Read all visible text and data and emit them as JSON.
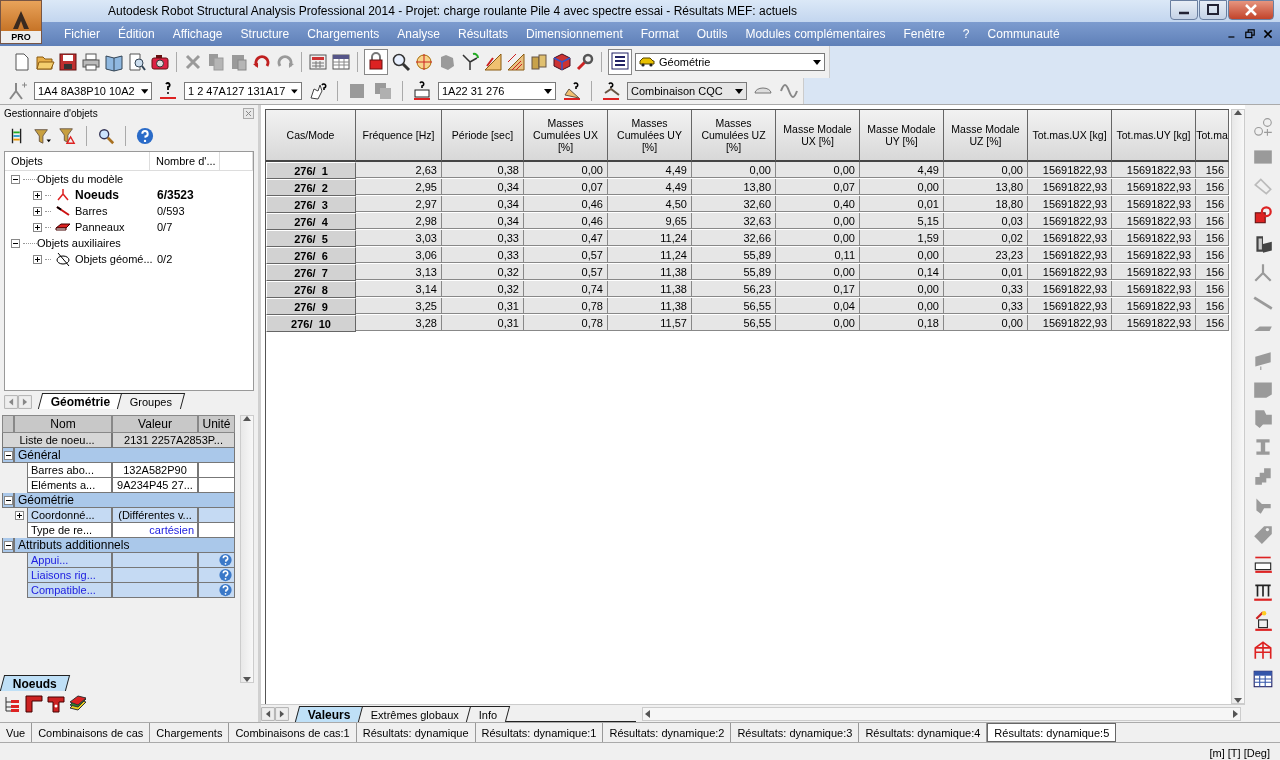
{
  "window": {
    "title": "Autodesk Robot Structural Analysis Professional 2014 - Projet: charge roulante Pile 4 avec spectre essai - Résultats MEF: actuels",
    "logo": "PRO"
  },
  "menu": [
    "Fichier",
    "Édition",
    "Affichage",
    "Structure",
    "Chargements",
    "Analyse",
    "Résultats",
    "Dimensionnement",
    "Format",
    "Outils",
    "Modules complémentaires",
    "Fenêtre",
    "?",
    "Communauté"
  ],
  "toolbar": {
    "view_selector": "Géométrie"
  },
  "selection_bar": {
    "nodes": "1A4 8A38P10 10A2",
    "bars": "1 2 47A127 131A17",
    "cases": "1A22 31 276",
    "combination": "Combinaison CQC"
  },
  "object_manager": {
    "title": "Gestionnaire d'objets",
    "columns": [
      "Objets",
      "Nombre d'..."
    ],
    "tree": [
      {
        "label": "Objets du modèle",
        "expanded": true,
        "children": [
          {
            "label": "Noeuds",
            "count": "6/3523",
            "selected": true,
            "expanded": false,
            "kind": "node"
          },
          {
            "label": "Barres",
            "count": "0/593",
            "selected": false,
            "expanded": false,
            "kind": "bar"
          },
          {
            "label": "Panneaux",
            "count": "0/7",
            "selected": false,
            "expanded": false,
            "kind": "panel"
          }
        ]
      },
      {
        "label": "Objets auxiliaires",
        "expanded": true,
        "children": [
          {
            "label": "Objets géomé...",
            "count": "0/2",
            "selected": false,
            "expanded": false,
            "kind": "geometry"
          }
        ]
      }
    ],
    "tabs": [
      {
        "label": "Géométrie",
        "selected": true
      },
      {
        "label": "Groupes",
        "selected": false
      }
    ]
  },
  "properties": {
    "columns": [
      "Nom",
      "Valeur",
      "Unité"
    ],
    "rows": [
      {
        "kind": "summary",
        "name": "Liste de noeu...",
        "value": "2131 2257A2853P..."
      },
      {
        "kind": "section",
        "name": "Général",
        "expanded": true,
        "children": [
          {
            "kind": "field",
            "name": "Barres abo...",
            "value": "132A582P90"
          },
          {
            "kind": "field",
            "name": "Eléments a...",
            "value": "9A234P45 27..."
          }
        ]
      },
      {
        "kind": "section",
        "name": "Géométrie",
        "expanded": true,
        "children": [
          {
            "kind": "group",
            "name": "Coordonné...",
            "value": "(Différentes v...",
            "expanded": false
          },
          {
            "kind": "choice",
            "name": "Type de re...",
            "value": "cartésien"
          }
        ]
      },
      {
        "kind": "section",
        "name": "Attributs additionnels",
        "expanded": true,
        "children": [
          {
            "kind": "link",
            "name": "Appui..."
          },
          {
            "kind": "link",
            "name": "Liaisons rig..."
          },
          {
            "kind": "link",
            "name": "Compatible..."
          }
        ]
      }
    ],
    "tabs": [
      {
        "label": "Noeuds",
        "selected": true
      }
    ]
  },
  "table": {
    "columns": [
      "Cas/Mode",
      "Fréquence [Hz]",
      "Période [sec]",
      "Masses Cumulées UX [%]",
      "Masses Cumulées UY [%]",
      "Masses Cumulées UZ [%]",
      "Masse Modale UX [%]",
      "Masse Modale UY [%]",
      "Masse Modale UZ [%]",
      "Tot.mas.UX [kg]",
      "Tot.mas.UY [kg]",
      "Tot.ma"
    ],
    "rows": [
      {
        "mode": "276/  1",
        "values": [
          "2,63",
          "0,38",
          "0,00",
          "4,49",
          "0,00",
          "0,00",
          "4,49",
          "0,00",
          "15691822,93",
          "15691822,93",
          "156"
        ]
      },
      {
        "mode": "276/  2",
        "values": [
          "2,95",
          "0,34",
          "0,07",
          "4,49",
          "13,80",
          "0,07",
          "0,00",
          "13,80",
          "15691822,93",
          "15691822,93",
          "156"
        ]
      },
      {
        "mode": "276/  3",
        "values": [
          "2,97",
          "0,34",
          "0,46",
          "4,50",
          "32,60",
          "0,40",
          "0,01",
          "18,80",
          "15691822,93",
          "15691822,93",
          "156"
        ]
      },
      {
        "mode": "276/  4",
        "values": [
          "2,98",
          "0,34",
          "0,46",
          "9,65",
          "32,63",
          "0,00",
          "5,15",
          "0,03",
          "15691822,93",
          "15691822,93",
          "156"
        ]
      },
      {
        "mode": "276/  5",
        "values": [
          "3,03",
          "0,33",
          "0,47",
          "11,24",
          "32,66",
          "0,00",
          "1,59",
          "0,02",
          "15691822,93",
          "15691822,93",
          "156"
        ]
      },
      {
        "mode": "276/  6",
        "values": [
          "3,06",
          "0,33",
          "0,57",
          "11,24",
          "55,89",
          "0,11",
          "0,00",
          "23,23",
          "15691822,93",
          "15691822,93",
          "156"
        ]
      },
      {
        "mode": "276/  7",
        "values": [
          "3,13",
          "0,32",
          "0,57",
          "11,38",
          "55,89",
          "0,00",
          "0,14",
          "0,01",
          "15691822,93",
          "15691822,93",
          "156"
        ]
      },
      {
        "mode": "276/  8",
        "values": [
          "3,14",
          "0,32",
          "0,74",
          "11,38",
          "56,23",
          "0,17",
          "0,00",
          "0,33",
          "15691822,93",
          "15691822,93",
          "156"
        ]
      },
      {
        "mode": "276/  9",
        "values": [
          "3,25",
          "0,31",
          "0,78",
          "11,38",
          "56,55",
          "0,04",
          "0,00",
          "0,33",
          "15691822,93",
          "15691822,93",
          "156"
        ]
      },
      {
        "mode": "276/  10",
        "values": [
          "3,28",
          "0,31",
          "0,78",
          "11,57",
          "56,55",
          "0,00",
          "0,18",
          "0,00",
          "15691822,93",
          "15691822,93",
          "156"
        ]
      }
    ],
    "tabs": [
      {
        "label": "Valeurs",
        "selected": true
      },
      {
        "label": "Extrêmes globaux",
        "selected": false
      },
      {
        "label": "Info",
        "selected": false
      }
    ]
  },
  "view_tabs": [
    {
      "label": "Vue",
      "selected": false
    },
    {
      "label": "Combinaisons de cas",
      "selected": false
    },
    {
      "label": "Chargements",
      "selected": false
    },
    {
      "label": "Combinaisons de cas:1",
      "selected": false
    },
    {
      "label": "Résultats: dynamique",
      "selected": false
    },
    {
      "label": "Résultats: dynamique:1",
      "selected": false
    },
    {
      "label": "Résultats: dynamique:2",
      "selected": false
    },
    {
      "label": "Résultats: dynamique:3",
      "selected": false
    },
    {
      "label": "Résultats: dynamique:4",
      "selected": false
    },
    {
      "label": "Résultats: dynamique:5",
      "selected": true
    }
  ],
  "status_bar": {
    "units": "[m] [T] [Deg]"
  }
}
